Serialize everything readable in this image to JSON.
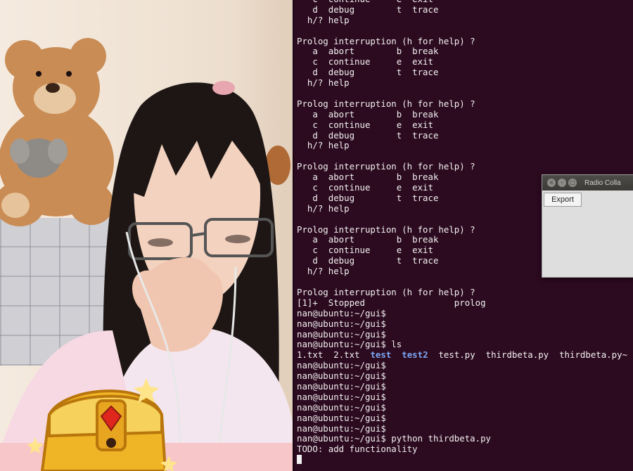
{
  "terminal": {
    "lines": [
      {
        "text": "   c  continue     e  exit"
      },
      {
        "text": "   d  debug        t  trace"
      },
      {
        "text": "  h/? help"
      },
      {
        "text": ""
      },
      {
        "text": "Prolog interruption (h for help) ?"
      },
      {
        "text": "   a  abort        b  break"
      },
      {
        "text": "   c  continue     e  exit"
      },
      {
        "text": "   d  debug        t  trace"
      },
      {
        "text": "  h/? help"
      },
      {
        "text": ""
      },
      {
        "text": "Prolog interruption (h for help) ?"
      },
      {
        "text": "   a  abort        b  break"
      },
      {
        "text": "   c  continue     e  exit"
      },
      {
        "text": "   d  debug        t  trace"
      },
      {
        "text": "  h/? help"
      },
      {
        "text": ""
      },
      {
        "text": "Prolog interruption (h for help) ?"
      },
      {
        "text": "   a  abort        b  break"
      },
      {
        "text": "   c  continue     e  exit"
      },
      {
        "text": "   d  debug        t  trace"
      },
      {
        "text": "  h/? help"
      },
      {
        "text": ""
      },
      {
        "text": "Prolog interruption (h for help) ?"
      },
      {
        "text": "   a  abort        b  break"
      },
      {
        "text": "   c  continue     e  exit"
      },
      {
        "text": "   d  debug        t  trace"
      },
      {
        "text": "  h/? help"
      },
      {
        "text": ""
      },
      {
        "text": "Prolog interruption (h for help) ?"
      },
      {
        "text": "[1]+  Stopped                 prolog"
      },
      {
        "text": "nan@ubuntu:~/gui$"
      },
      {
        "text": "nan@ubuntu:~/gui$"
      },
      {
        "text": "nan@ubuntu:~/gui$"
      },
      {
        "text": "nan@ubuntu:~/gui$ ls"
      },
      {
        "ls": true
      },
      {
        "text": "nan@ubuntu:~/gui$"
      },
      {
        "text": "nan@ubuntu:~/gui$"
      },
      {
        "text": "nan@ubuntu:~/gui$"
      },
      {
        "text": "nan@ubuntu:~/gui$"
      },
      {
        "text": "nan@ubuntu:~/gui$"
      },
      {
        "text": "nan@ubuntu:~/gui$"
      },
      {
        "text": "nan@ubuntu:~/gui$"
      },
      {
        "text": "nan@ubuntu:~/gui$ python thirdbeta.py"
      },
      {
        "text": "TODO: add functionality"
      },
      {
        "cursor": true
      }
    ],
    "ls_entries": [
      {
        "name": "1.txt",
        "dir": false
      },
      {
        "name": "2.txt",
        "dir": false
      },
      {
        "name": "test",
        "dir": true
      },
      {
        "name": "test2",
        "dir": true
      },
      {
        "name": "test.py",
        "dir": false
      },
      {
        "name": "thirdbeta.py",
        "dir": false
      },
      {
        "name": "thirdbeta.py~",
        "dir": false
      }
    ],
    "colors": {
      "background": "#2c0a1f",
      "text": "#f2f2f2",
      "directory": "#7aa6f2"
    }
  },
  "mini_window": {
    "title": "Radio Colla",
    "export_label": "Export"
  }
}
